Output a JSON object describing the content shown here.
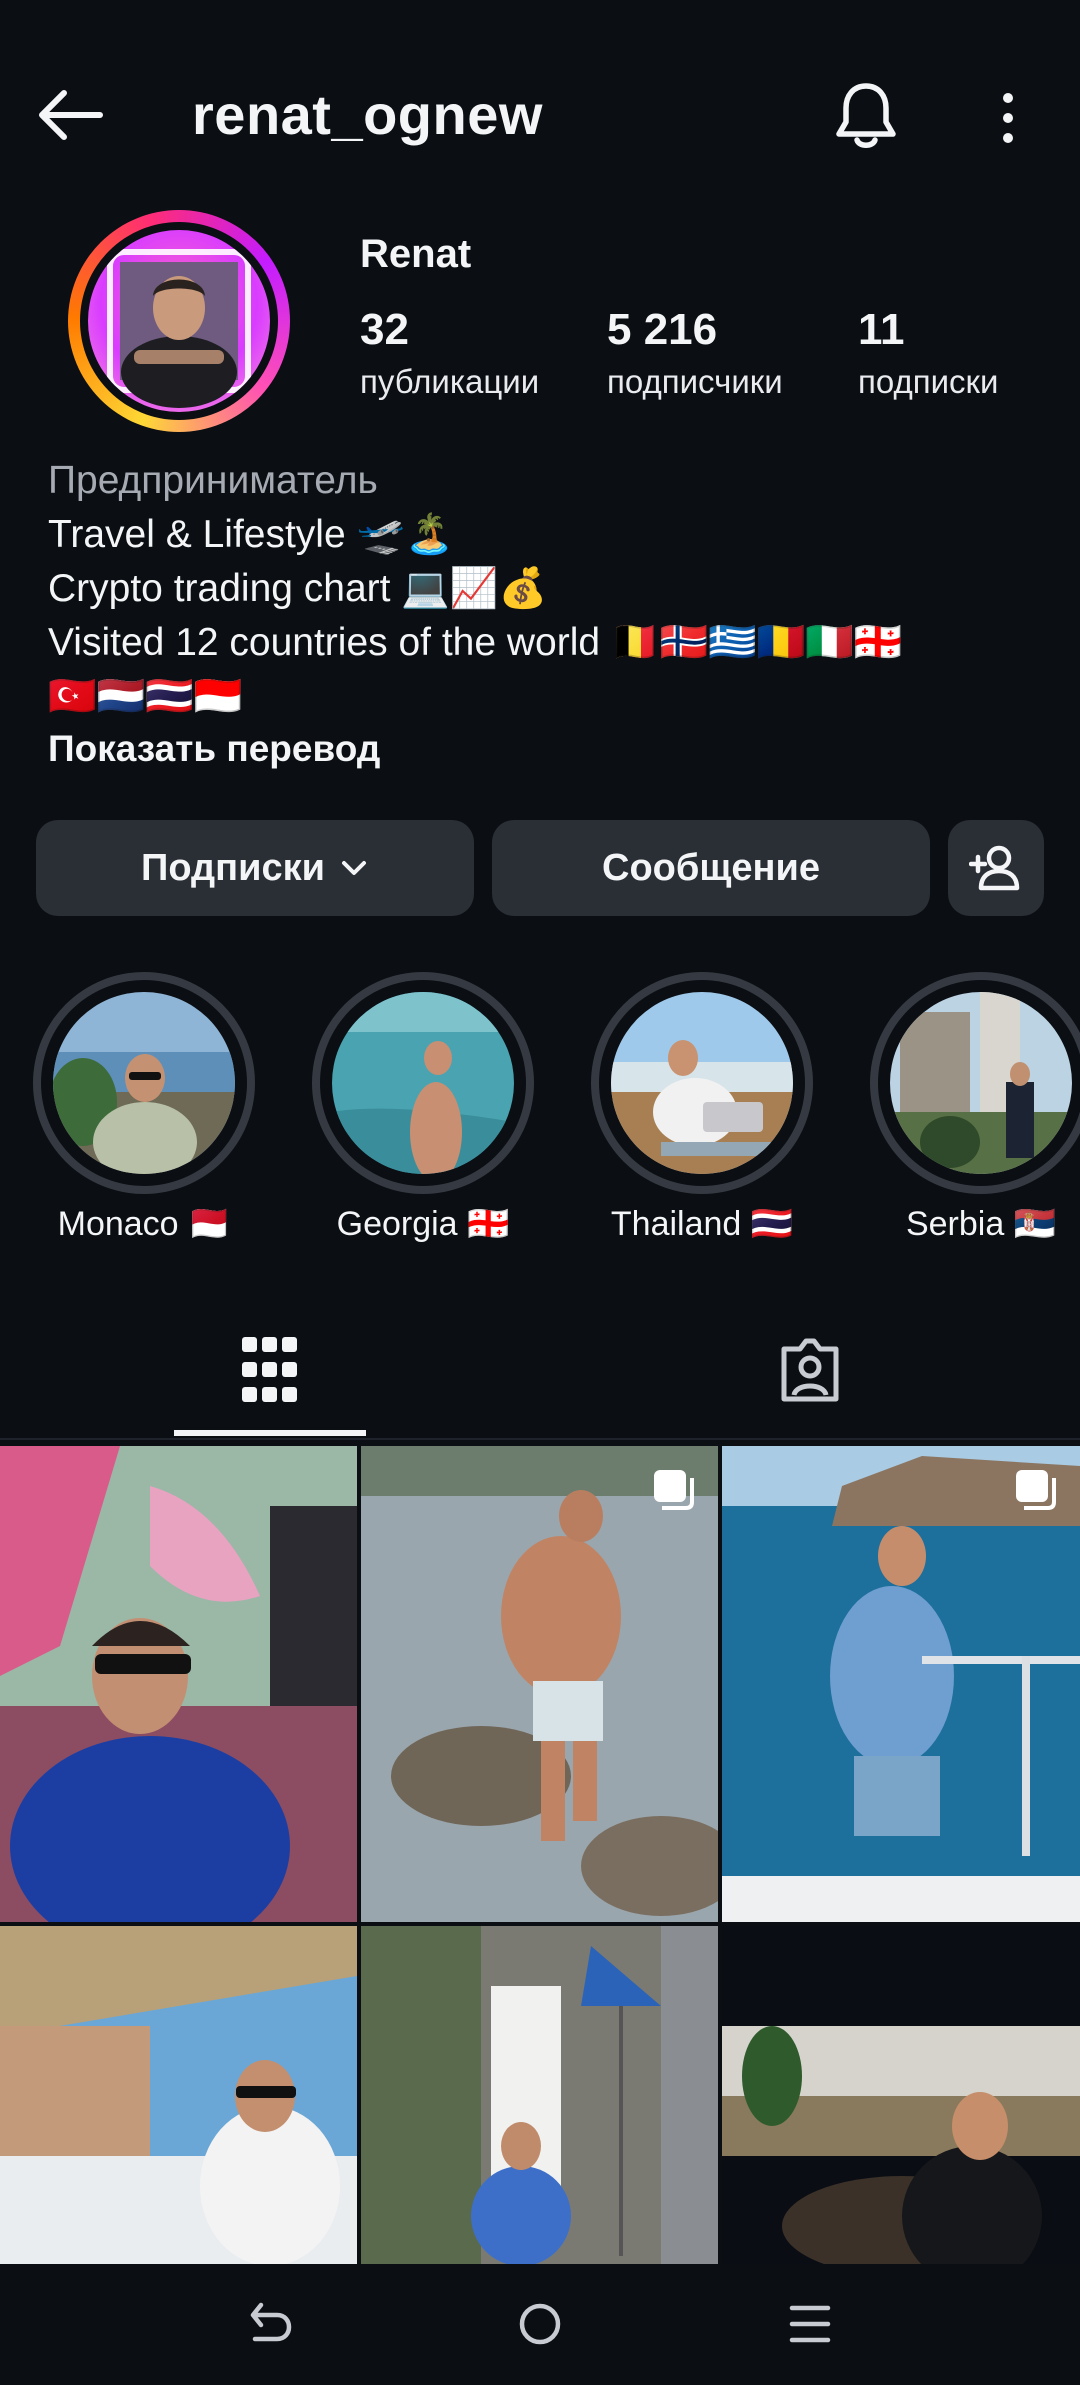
{
  "header": {
    "username": "renat_ognew",
    "icons": [
      "back-arrow-icon",
      "bell-icon",
      "more-vertical-icon"
    ]
  },
  "profile": {
    "name": "Renat",
    "stats": [
      {
        "value": "32",
        "label": "публикации"
      },
      {
        "value": "5 216",
        "label": "подписчики"
      },
      {
        "value": "11",
        "label": "подписки"
      }
    ]
  },
  "bio": {
    "category": "Предприниматель",
    "line1": "Travel & Lifestyle 🛫🏝️",
    "line2": "Crypto trading chart 💻📈💰",
    "line3": "Visited 12 countries of the world 🇧🇪🇳🇴🇬🇷🇷🇴🇮🇹🇬🇪",
    "line4": "🇹🇷🇳🇱🇹🇭🇮🇩",
    "show_translation": "Показать перевод"
  },
  "actions": {
    "following_label": "Подписки",
    "message_label": "Сообщение"
  },
  "highlights": [
    {
      "label": "Monaco 🇲🇨"
    },
    {
      "label": "Georgia 🇬🇪"
    },
    {
      "label": "Thailand 🇹🇭"
    },
    {
      "label": "Serbia 🇷🇸"
    }
  ],
  "tabs": [
    "grid-icon",
    "tagged-icon"
  ],
  "colors": {
    "background": "#0b0e13",
    "button": "#2a2e35",
    "text": "#f3f5f7",
    "muted": "#a6abb3"
  }
}
